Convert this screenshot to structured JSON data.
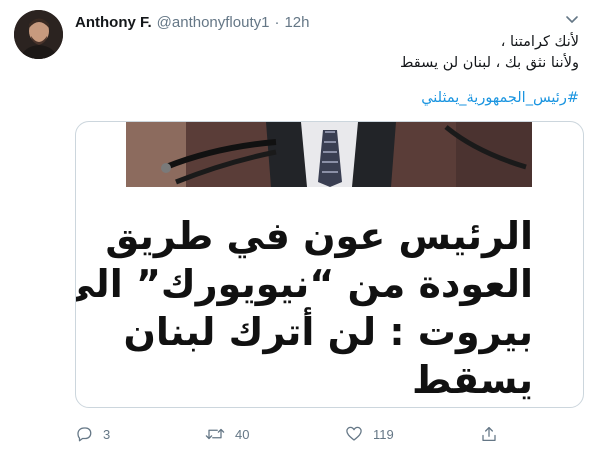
{
  "tweet": {
    "author_name": "Anthony F.",
    "handle": "@anthonyflouty1",
    "separator": "·",
    "time": "12h",
    "text_line1": "لأنك كرامتنا ،",
    "text_line2": "ولأننا نثق بك ، لبنان لن يسقط",
    "hashtag": "#رئيس_الجمهورية_يمثلني",
    "card": {
      "headline_line1": "الرئيس عون في طريق",
      "headline_line2": "العودة من “نيويورك” الى",
      "headline_line3": "بيروت : لن أترك لبنان",
      "headline_line4": "يسقط"
    },
    "actions": {
      "reply_count": "3",
      "retweet_count": "40",
      "like_count": "119"
    }
  },
  "icons": {
    "avatar": "user-avatar",
    "menu": "chevron-down-icon",
    "reply": "reply-icon",
    "retweet": "retweet-icon",
    "like": "heart-icon",
    "share": "share-icon"
  },
  "colors": {
    "link": "#1b95e0",
    "secondary_text": "#657786",
    "border": "#ccd6dd"
  }
}
